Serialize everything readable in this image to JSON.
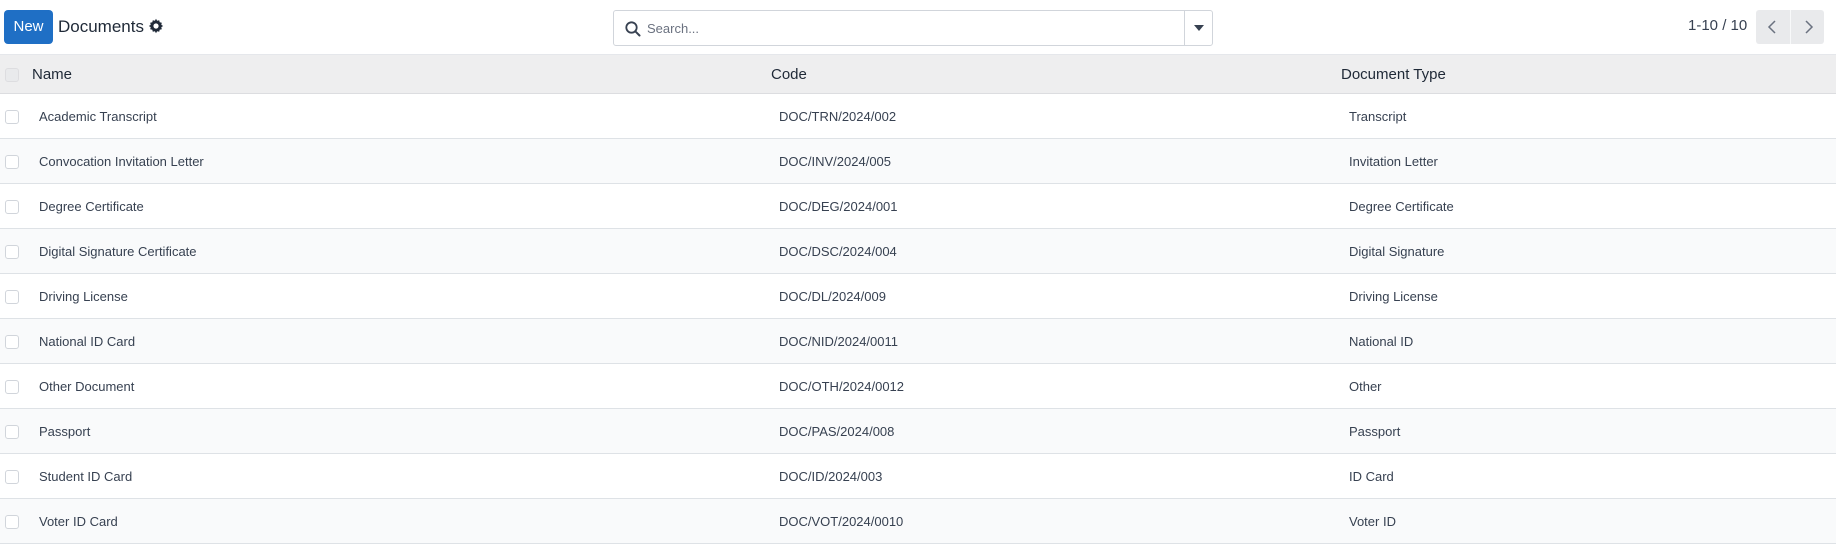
{
  "control_panel": {
    "new_label": "New",
    "title": "Documents",
    "search_placeholder": "Search...",
    "pager": "1-10 / 10",
    "icons": {
      "gear": "gear-icon",
      "search": "search-icon",
      "toggle": "caret-down-icon",
      "prev": "chevron-left-icon",
      "next": "chevron-right-icon"
    }
  },
  "table": {
    "columns": [
      "Name",
      "Code",
      "Document Type"
    ],
    "rows": [
      {
        "name": "Academic Transcript",
        "code": "DOC/TRN/2024/002",
        "type": "Transcript"
      },
      {
        "name": "Convocation Invitation Letter",
        "code": "DOC/INV/2024/005",
        "type": "Invitation Letter"
      },
      {
        "name": "Degree Certificate",
        "code": "DOC/DEG/2024/001",
        "type": "Degree Certificate"
      },
      {
        "name": "Digital Signature Certificate",
        "code": "DOC/DSC/2024/004",
        "type": "Digital Signature"
      },
      {
        "name": "Driving License",
        "code": "DOC/DL/2024/009",
        "type": "Driving License"
      },
      {
        "name": "National ID Card",
        "code": "DOC/NID/2024/0011",
        "type": "National ID"
      },
      {
        "name": "Other Document",
        "code": "DOC/OTH/2024/0012",
        "type": "Other"
      },
      {
        "name": "Passport",
        "code": "DOC/PAS/2024/008",
        "type": "Passport"
      },
      {
        "name": "Student ID Card",
        "code": "DOC/ID/2024/003",
        "type": "ID Card"
      },
      {
        "name": "Voter ID Card",
        "code": "DOC/VOT/2024/0010",
        "type": "Voter ID"
      }
    ]
  },
  "colors": {
    "primary": "#1f6fc5",
    "header_bg": "#eeeeef",
    "row_stripe": "#f9fafb"
  }
}
